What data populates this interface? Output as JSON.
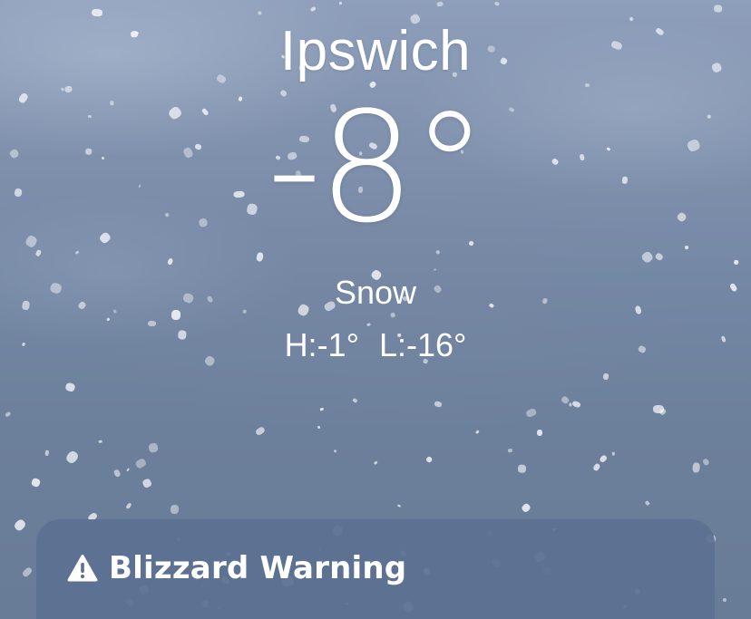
{
  "location": {
    "city": "Ipswich",
    "temperature": "-8°",
    "condition": "Snow",
    "high": "H:-1°",
    "low": "L:-16°"
  },
  "alert": {
    "icon": "warning-triangle-icon",
    "title": "Blizzard Warning"
  },
  "colors": {
    "sky_top": "#8e9fbb",
    "sky_bottom": "#687b97",
    "alert_card": "#5c7092",
    "text": "#ffffff"
  }
}
